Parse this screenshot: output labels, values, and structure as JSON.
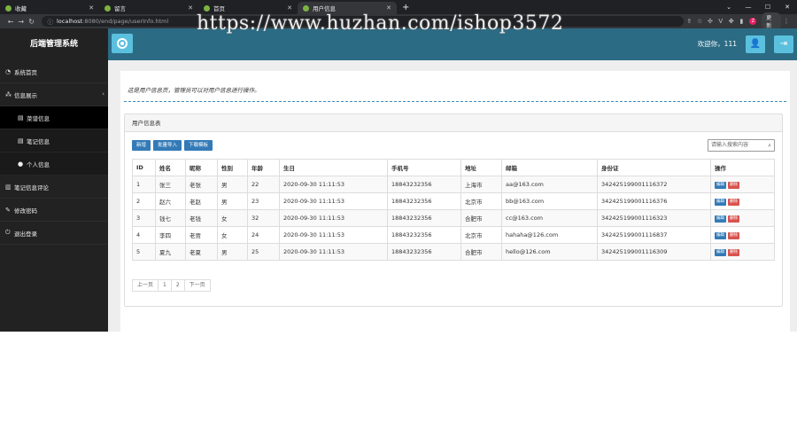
{
  "browser": {
    "tabs": [
      {
        "title": "收藏",
        "active": false
      },
      {
        "title": "留言",
        "active": false
      },
      {
        "title": "首页",
        "active": false
      },
      {
        "title": "用户信息",
        "active": true
      }
    ],
    "url_host": "localhost",
    "url_path": ":8080/end/page/userInfo.html",
    "update_label": "更新",
    "profile_letter": "Z"
  },
  "watermark": "https://www.huzhan.com/ishop3572",
  "app": {
    "brand": "后端管理系统",
    "welcome": "欢迎你，111"
  },
  "sidebar": {
    "items": [
      {
        "label": "系统首页"
      },
      {
        "label": "信息展示",
        "caret": "‹"
      },
      {
        "label": "菜谱信息",
        "sub": true,
        "active": true
      },
      {
        "label": "笔记信息",
        "sub": true
      },
      {
        "label": "个人信息",
        "sub": true
      },
      {
        "label": "笔记信息评论"
      },
      {
        "label": "修改密码"
      },
      {
        "label": "退出登录"
      }
    ]
  },
  "main": {
    "intro": "这是用户信息页，管理员可以对用户信息进行操作。",
    "panel_title": "用户信息表",
    "buttons": {
      "add": "新增",
      "import": "批量导入",
      "template": "下载模板"
    },
    "search_placeholder": "请输入搜索内容",
    "table": {
      "headers": [
        "ID",
        "姓名",
        "昵称",
        "性别",
        "年龄",
        "生日",
        "手机号",
        "地址",
        "邮箱",
        "身份证",
        "操作"
      ],
      "rows": [
        [
          "1",
          "张三",
          "老张",
          "男",
          "22",
          "2020-09-30 11:11:53",
          "18843232356",
          "上海市",
          "aa@163.com",
          "342425199001116372"
        ],
        [
          "2",
          "赵六",
          "老赵",
          "男",
          "23",
          "2020-09-30 11:11:53",
          "18843232356",
          "北京市",
          "bb@163.com",
          "342425199001116376"
        ],
        [
          "3",
          "钱七",
          "老钱",
          "女",
          "32",
          "2020-09-30 11:11:53",
          "18843232356",
          "合肥市",
          "cc@163.com",
          "342425199001116323"
        ],
        [
          "4",
          "李四",
          "老贾",
          "女",
          "24",
          "2020-09-30 11:11:53",
          "18843232356",
          "北京市",
          "hahaha@126.com",
          "342425199001116837"
        ],
        [
          "5",
          "夏九",
          "老夏",
          "男",
          "25",
          "2020-09-30 11:11:53",
          "18843232356",
          "合肥市",
          "hello@126.com",
          "342425199001116309"
        ]
      ],
      "edit_label": "编辑",
      "delete_label": "删除"
    },
    "pager": {
      "prev": "上一页",
      "pages": [
        "1",
        "2"
      ],
      "next": "下一页"
    }
  }
}
